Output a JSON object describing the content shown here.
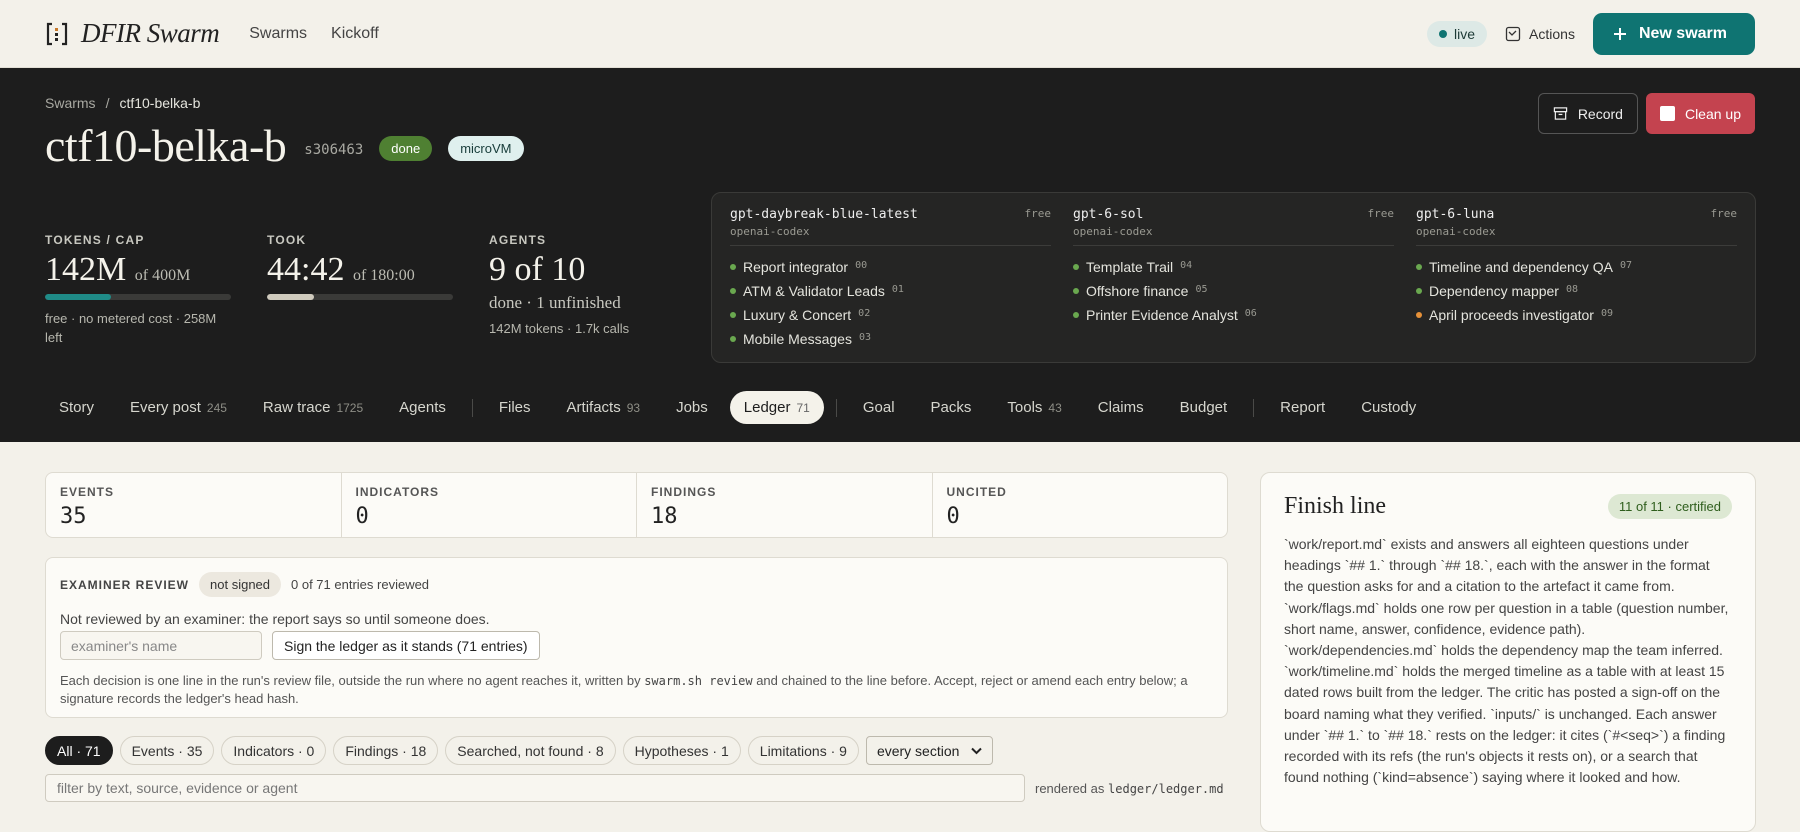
{
  "app": {
    "brand": "DFIR Swarm",
    "nav": [
      "Swarms",
      "Kickoff"
    ]
  },
  "topright": {
    "live": "live",
    "actions": "Actions",
    "new_swarm": "New swarm",
    "accent": "#0f7472"
  },
  "hero": {
    "breadcrumb": {
      "root": "Swarms",
      "sep": "/",
      "current": "ctf10-belka-b"
    },
    "title": "ctf10-belka-b",
    "id": "s306463",
    "status_badge": "done",
    "vm_badge": "microVM",
    "record_label": "Record",
    "cleanup_label": "Clean up"
  },
  "stats": {
    "tokens": {
      "label": "TOKENS / CAP",
      "value": "142M",
      "cap": "of 400M",
      "progress": 0.355,
      "sub": "free · no metered cost · 258M left"
    },
    "took": {
      "label": "TOOK",
      "value": "44:42",
      "cap": "of 180:00",
      "progress": 0.25
    },
    "agents": {
      "label": "AGENTS",
      "value": "9 of 10",
      "sub1": "done · 1 unfinished",
      "sub2": "142M tokens · 1.7k calls"
    }
  },
  "models": [
    {
      "name": "gpt-daybreak-blue-latest",
      "provider": "openai-codex",
      "tier": "free",
      "agents": [
        {
          "label": "Report integrator",
          "num": "00",
          "color": "#6aa84f"
        },
        {
          "label": "ATM & Validator Leads",
          "num": "01",
          "color": "#6aa84f"
        },
        {
          "label": "Luxury & Concert",
          "num": "02",
          "color": "#6aa84f"
        },
        {
          "label": "Mobile Messages",
          "num": "03",
          "color": "#6aa84f"
        }
      ]
    },
    {
      "name": "gpt-6-sol",
      "provider": "openai-codex",
      "tier": "free",
      "agents": [
        {
          "label": "Template Trail",
          "num": "04",
          "color": "#6aa84f"
        },
        {
          "label": "Offshore finance",
          "num": "05",
          "color": "#6aa84f"
        },
        {
          "label": "Printer Evidence Analyst",
          "num": "06",
          "color": "#6aa84f"
        }
      ]
    },
    {
      "name": "gpt-6-luna",
      "provider": "openai-codex",
      "tier": "free",
      "agents": [
        {
          "label": "Timeline and dependency QA",
          "num": "07",
          "color": "#6aa84f"
        },
        {
          "label": "Dependency mapper",
          "num": "08",
          "color": "#6aa84f"
        },
        {
          "label": "April proceeds investigator",
          "num": "09",
          "color": "#e69138"
        }
      ]
    }
  ],
  "tabs": [
    {
      "label": "Story",
      "count": ""
    },
    {
      "label": "Every post",
      "count": "245"
    },
    {
      "label": "Raw trace",
      "count": "1725"
    },
    {
      "label": "Agents",
      "count": ""
    },
    {
      "sep": true
    },
    {
      "label": "Files",
      "count": ""
    },
    {
      "label": "Artifacts",
      "count": "93"
    },
    {
      "label": "Jobs",
      "count": ""
    },
    {
      "label": "Ledger",
      "count": "71",
      "active": true
    },
    {
      "sep": true
    },
    {
      "label": "Goal",
      "count": ""
    },
    {
      "label": "Packs",
      "count": ""
    },
    {
      "label": "Tools",
      "count": "43"
    },
    {
      "label": "Claims",
      "count": ""
    },
    {
      "label": "Budget",
      "count": ""
    },
    {
      "sep": true
    },
    {
      "label": "Report",
      "count": ""
    },
    {
      "label": "Custody",
      "count": ""
    }
  ],
  "kpis": [
    {
      "label": "EVENTS",
      "value": "35"
    },
    {
      "label": "INDICATORS",
      "value": "0"
    },
    {
      "label": "FINDINGS",
      "value": "18"
    },
    {
      "label": "UNCITED",
      "value": "0"
    }
  ],
  "review": {
    "label": "EXAMINER REVIEW",
    "status": "not signed",
    "count": "0 of 71 entries reviewed",
    "note": "Not reviewed by an examiner: the report says so until someone does.",
    "name_placeholder": "examiner's name",
    "sign_button": "Sign the ledger as it stands (71 entries)",
    "help_a": "Each decision is one line in the run's review file, outside the run where no agent reaches it, written by ",
    "help_code": "swarm.sh review",
    "help_b": " and chained to the line before. Accept, reject or amend each entry below; a signature records the ledger's head hash."
  },
  "filters": {
    "chips": [
      "All · 71",
      "Events · 35",
      "Indicators · 0",
      "Findings · 18",
      "Searched, not found · 8",
      "Hypotheses · 1",
      "Limitations · 9"
    ],
    "select": "every section",
    "search_placeholder": "filter by text, source, evidence or agent",
    "rendered_prefix": "rendered as",
    "rendered_path": "ledger/ledger.md"
  },
  "finish": {
    "title": "Finish line",
    "badge": "11 of 11 · certified",
    "body": "`work/report.md` exists and answers all eighteen questions under headings `## 1.` through `## 18.`, each with the answer in the format the question asks for and a citation to the artefact it came from. `work/flags.md` holds one row per question in a table (question number, short name, answer, confidence, evidence path). `work/dependencies.md` holds the dependency map the team inferred. `work/timeline.md` holds the merged timeline as a table with at least 15 dated rows built from the ledger. The critic has posted a sign-off on the board naming what they verified. `inputs/` is unchanged. Each answer under `## 1.` to `## 18.` rests on the ledger: it cites (`#<seq>`) a finding recorded with its refs (the run's objects it rests on), or a search that found nothing (`kind=absence`) saying where it looked and how."
  }
}
